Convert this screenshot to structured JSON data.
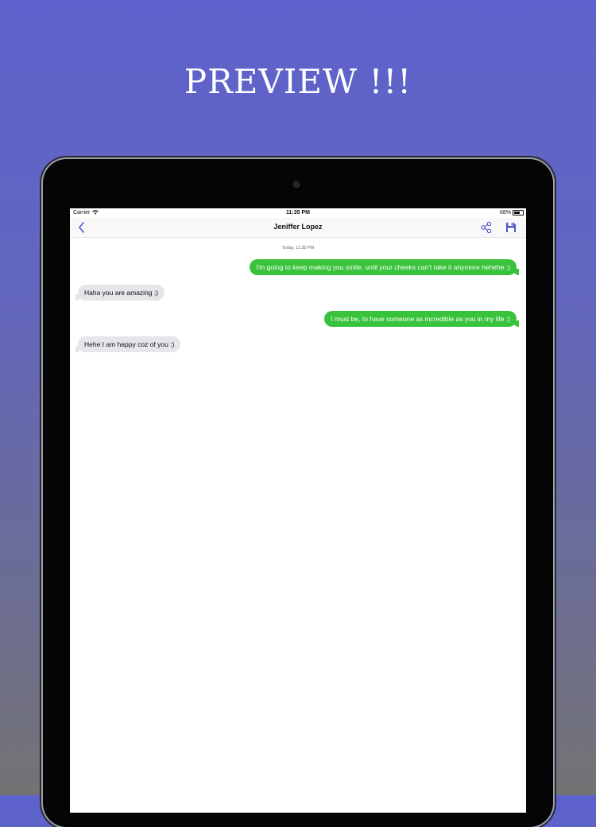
{
  "headline": "PREVIEW !!!",
  "status_bar": {
    "carrier": "Carrier",
    "time": "11:35 PM",
    "battery": "68%"
  },
  "nav": {
    "back_icon": "chevron-left-icon",
    "title": "Jeniffer Lopez",
    "share_icon": "share-icon",
    "save_icon": "save-icon"
  },
  "chat": {
    "date_label": "Today, 11:35 PM",
    "messages": [
      {
        "direction": "sent",
        "text": "I'm going to keep making you smile, until your cheeks can't take it anymore hehehe :)"
      },
      {
        "direction": "received",
        "text": "Haha you are amazing ;)"
      },
      {
        "direction": "sent",
        "text": "I must be, to have someone as incredible as you in my life :)"
      },
      {
        "direction": "received",
        "text": "Hehe I am happy coz of you :)"
      }
    ]
  },
  "colors": {
    "accent": "#4d55c8",
    "sent_bubble": "#39c23b",
    "received_bubble": "#e6e6ea",
    "background_top": "#5e62cc",
    "background_bottom": "#737373"
  }
}
